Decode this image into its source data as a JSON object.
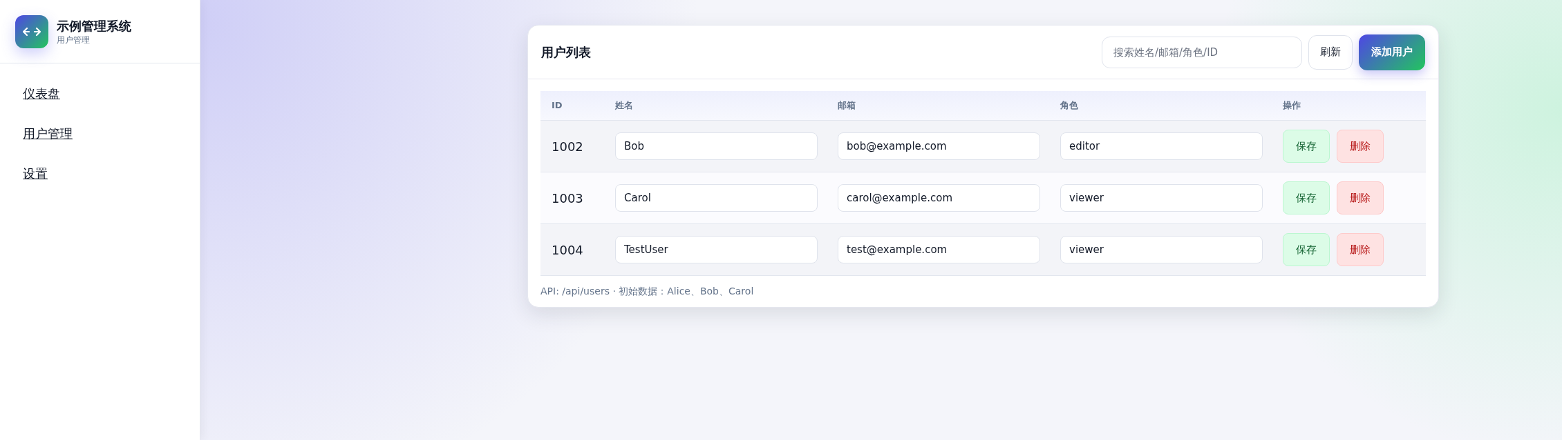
{
  "sidebar": {
    "app_title": "示例管理系统",
    "app_subtitle": "用户管理",
    "items": [
      {
        "label": "仪表盘"
      },
      {
        "label": "用户管理"
      },
      {
        "label": "设置"
      }
    ]
  },
  "card": {
    "title": "用户列表",
    "search": {
      "placeholder": "搜索姓名/邮箱/角色/ID"
    },
    "refresh_button": "刷新",
    "add_button": "添加用户",
    "table": {
      "columns": [
        "ID",
        "姓名",
        "邮箱",
        "角色",
        "操作"
      ],
      "rows": [
        {
          "id": "1002",
          "name": "Bob",
          "email": "bob@example.com",
          "role": "editor",
          "save": "保存",
          "delete": "删除"
        },
        {
          "id": "1003",
          "name": "Carol",
          "email": "carol@example.com",
          "role": "viewer",
          "save": "保存",
          "delete": "删除"
        },
        {
          "id": "1004",
          "name": "TestUser",
          "email": "test@example.com",
          "role": "viewer",
          "save": "保存",
          "delete": "删除"
        }
      ]
    },
    "footer": "API: /api/users · 初始数据：Alice、Bob、Carol"
  }
}
